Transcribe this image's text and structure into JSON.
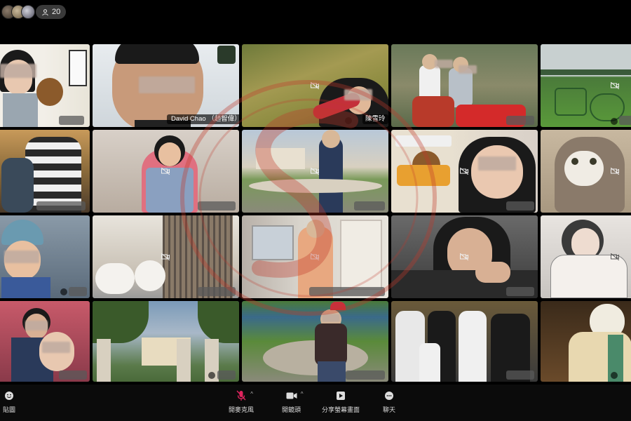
{
  "topbar": {
    "participant_count": "20",
    "people_icon": "people-icon"
  },
  "tiles": [
    {
      "label": ""
    },
    {
      "label": "David Chao （趙智偉）"
    },
    {
      "label": "陳雪玲"
    },
    {
      "label": ""
    },
    {
      "label": ""
    }
  ],
  "toolbar": {
    "reactions_label": "貼圖",
    "mic_label": "開麥克風",
    "camera_label": "開鏡頭",
    "share_label": "分享螢幕畫面",
    "chat_label": "聊天"
  },
  "colors": {
    "background": "#000000",
    "toolbar_bg": "#0b0b0b",
    "pill_bg": "#3a3a3a",
    "mic_muted": "#e0245e",
    "watermark": "#c0392b"
  }
}
